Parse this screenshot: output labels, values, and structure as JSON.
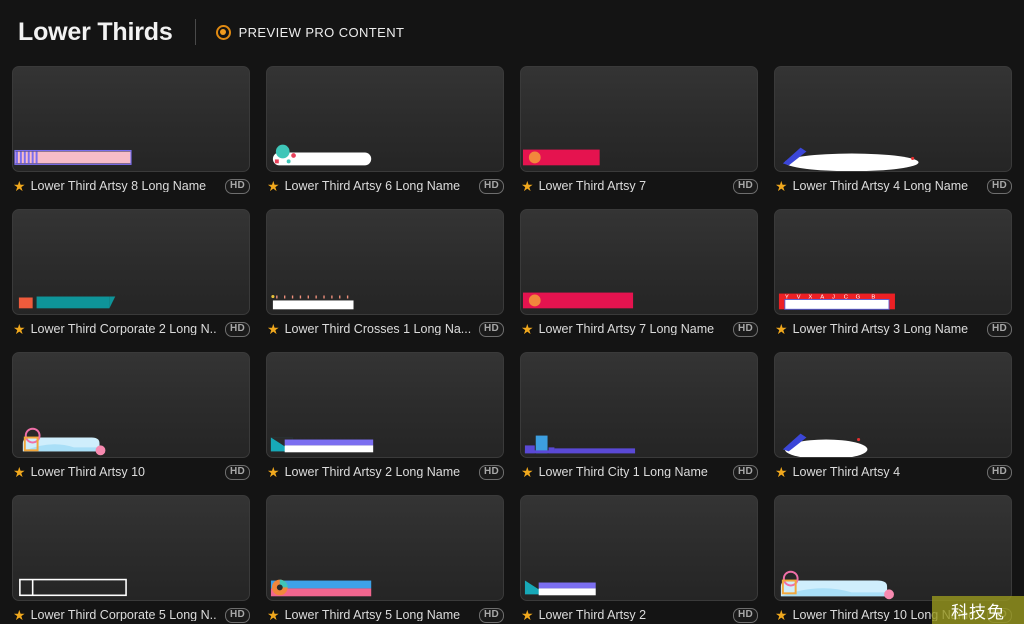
{
  "header": {
    "title": "Lower Thirds",
    "preview_pro_label": "PREVIEW PRO CONTENT",
    "radio_icon": "radio-filled-icon",
    "accent_color": "#f29c1f"
  },
  "badges": {
    "hd_label": "HD",
    "star_icon": "star-icon",
    "star_color": "#f0a81e"
  },
  "watermark": {
    "text": "科技兔",
    "bg_color": "#96961e"
  },
  "grid": {
    "columns": 4,
    "items": [
      {
        "name": "Lower Third Artsy 8 Long Name",
        "hd": "HD",
        "favorite": true,
        "art": "artsy8"
      },
      {
        "name": "Lower Third Artsy 6 Long Name",
        "hd": "HD",
        "favorite": true,
        "art": "artsy6"
      },
      {
        "name": "Lower Third Artsy 7",
        "hd": "HD",
        "favorite": true,
        "art": "artsy7s"
      },
      {
        "name": "Lower Third Artsy 4 Long Name",
        "hd": "HD",
        "favorite": true,
        "art": "artsy4"
      },
      {
        "name": "Lower Third Corporate 2 Long N..",
        "hd": "HD",
        "favorite": true,
        "art": "corp2"
      },
      {
        "name": "Lower Third Crosses 1 Long Na...",
        "hd": "HD",
        "favorite": true,
        "art": "crosses1"
      },
      {
        "name": "Lower Third Artsy 7 Long Name",
        "hd": "HD",
        "favorite": true,
        "art": "artsy7l"
      },
      {
        "name": "Lower Third Artsy 3 Long Name",
        "hd": "HD",
        "favorite": true,
        "art": "artsy3"
      },
      {
        "name": "Lower Third Artsy 10",
        "hd": "HD",
        "favorite": true,
        "art": "artsy10s"
      },
      {
        "name": "Lower Third Artsy 2 Long Name",
        "hd": "HD",
        "favorite": true,
        "art": "artsy2l"
      },
      {
        "name": "Lower Third City 1 Long Name",
        "hd": "HD",
        "favorite": true,
        "art": "city1"
      },
      {
        "name": "Lower Third Artsy 4",
        "hd": "HD",
        "favorite": true,
        "art": "artsy4s"
      },
      {
        "name": "Lower Third Corporate 5 Long N..",
        "hd": "HD",
        "favorite": true,
        "art": "corp5"
      },
      {
        "name": "Lower Third Artsy 5 Long Name",
        "hd": "HD",
        "favorite": true,
        "art": "artsy5"
      },
      {
        "name": "Lower Third Artsy 2",
        "hd": "HD",
        "favorite": true,
        "art": "artsy2s"
      },
      {
        "name": "Lower Third Artsy 10 Long Name",
        "hd": "HD",
        "favorite": true,
        "art": "artsy10l"
      }
    ]
  }
}
